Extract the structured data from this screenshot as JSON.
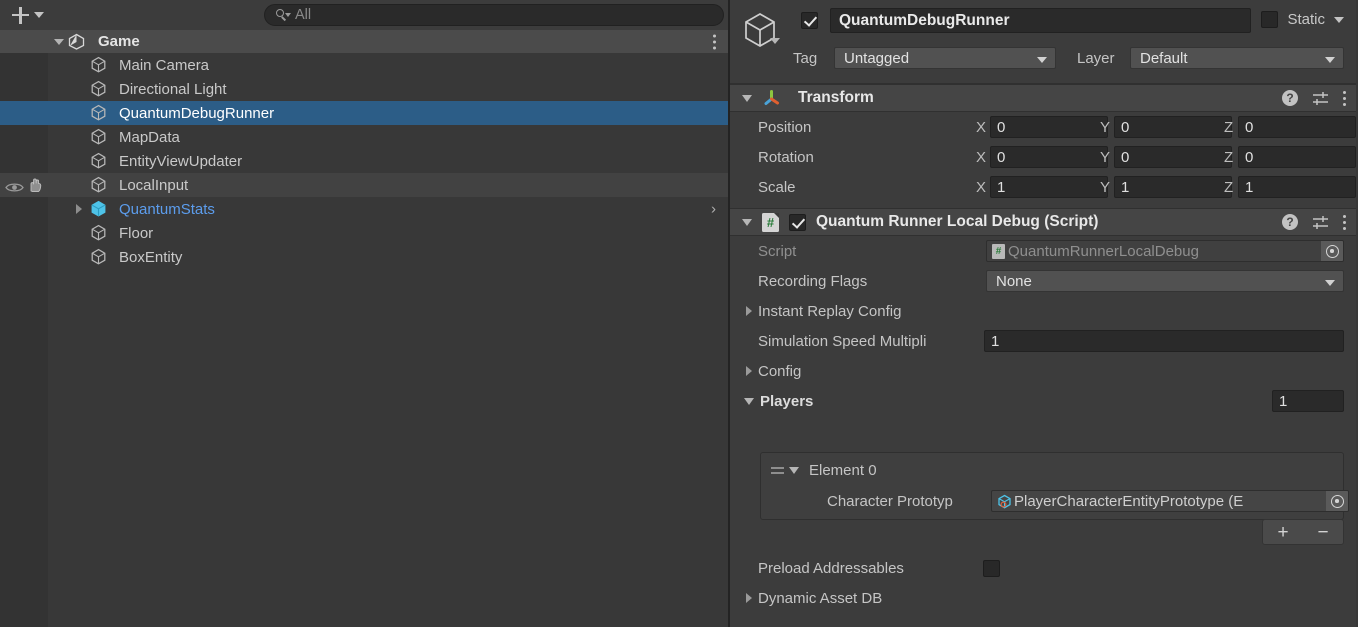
{
  "hierarchy": {
    "toolbar": {
      "add_button_label": "+",
      "add_icon": "plus-icon",
      "dropdown_icon": "chevron-down-icon",
      "search_placeholder": "All",
      "search_value": "",
      "search_icon": "search-icon"
    },
    "scene": {
      "label": "Game",
      "icon": "unity-scene-icon",
      "expanded": true,
      "menu_icon": "kebab-menu-icon"
    },
    "items": [
      {
        "label": "Main Camera",
        "icon": "gameobject-cube-icon",
        "selected": false,
        "prefab": false,
        "indent": 1,
        "expandable": false,
        "hovered": false,
        "visibility_toggles": false
      },
      {
        "label": "Directional Light",
        "icon": "gameobject-cube-icon",
        "selected": false,
        "prefab": false,
        "indent": 1,
        "expandable": false,
        "hovered": false,
        "visibility_toggles": false
      },
      {
        "label": "QuantumDebugRunner",
        "icon": "gameobject-cube-icon",
        "selected": true,
        "prefab": false,
        "indent": 1,
        "expandable": false,
        "hovered": false,
        "visibility_toggles": false
      },
      {
        "label": "MapData",
        "icon": "gameobject-cube-icon",
        "selected": false,
        "prefab": false,
        "indent": 1,
        "expandable": false,
        "hovered": false,
        "visibility_toggles": false
      },
      {
        "label": "EntityViewUpdater",
        "icon": "gameobject-cube-icon",
        "selected": false,
        "prefab": false,
        "indent": 1,
        "expandable": false,
        "hovered": false,
        "visibility_toggles": false
      },
      {
        "label": "LocalInput",
        "icon": "gameobject-cube-icon",
        "selected": false,
        "prefab": false,
        "indent": 1,
        "expandable": false,
        "hovered": true,
        "visibility_toggles": true
      },
      {
        "label": "QuantumStats",
        "icon": "prefab-cube-icon",
        "selected": false,
        "prefab": true,
        "indent": 1,
        "expandable": true,
        "hovered": false,
        "visibility_toggles": false
      },
      {
        "label": "Floor",
        "icon": "gameobject-cube-icon",
        "selected": false,
        "prefab": false,
        "indent": 1,
        "expandable": false,
        "hovered": false,
        "visibility_toggles": false
      },
      {
        "label": "BoxEntity",
        "icon": "gameobject-cube-icon",
        "selected": false,
        "prefab": false,
        "indent": 1,
        "expandable": false,
        "hovered": false,
        "visibility_toggles": false
      }
    ]
  },
  "inspector": {
    "gameobject": {
      "icon": "gameobject-cube-icon",
      "enabled": true,
      "name": "QuantumDebugRunner",
      "static_checked": false,
      "static_label": "Static",
      "tag_label": "Tag",
      "tag_value": "Untagged",
      "layer_label": "Layer",
      "layer_value": "Default"
    },
    "transform": {
      "title": "Transform",
      "icon": "transform-axis-icon",
      "expanded": true,
      "help_icon": "help-icon",
      "preset_icon": "preset-sliders-icon",
      "menu_icon": "kebab-menu-icon",
      "rows": [
        {
          "label": "Position",
          "x": "0",
          "y": "0",
          "z": "0"
        },
        {
          "label": "Rotation",
          "x": "0",
          "y": "0",
          "z": "0"
        },
        {
          "label": "Scale",
          "x": "1",
          "y": "1",
          "z": "1"
        }
      ],
      "axis_labels": [
        "X",
        "Y",
        "Z"
      ]
    },
    "script_component": {
      "title": "Quantum Runner Local Debug (Script)",
      "icon": "csharp-script-icon",
      "enabled": true,
      "expanded": true,
      "help_icon": "help-icon",
      "preset_icon": "preset-sliders-icon",
      "menu_icon": "kebab-menu-icon",
      "script_label": "Script",
      "script_value": "QuantumRunnerLocalDebug",
      "recording_flags_label": "Recording Flags",
      "recording_flags_value": "None",
      "instant_replay_label": "Instant Replay Config",
      "instant_replay_expanded": false,
      "sim_speed_label": "Simulation Speed Multipli",
      "sim_speed_value": "1",
      "config_label": "Config",
      "config_expanded": false,
      "players_label": "Players",
      "players_expanded": true,
      "players_count": "1",
      "element_label": "Element 0",
      "element_expanded": true,
      "character_prototype_label": "Character Prototyp",
      "character_prototype_value": "PlayerCharacterEntityPrototype (E",
      "add_button": "+",
      "remove_button": "−",
      "preload_label": "Preload Addressables",
      "preload_checked": false,
      "dynamic_asset_label": "Dynamic Asset DB",
      "dynamic_asset_expanded": false
    }
  },
  "colors": {
    "selection_blue": "#2c5d87",
    "prefab_blue": "#5c9ded",
    "panel_bg": "#383838",
    "inspector_bg": "#3c3c3c",
    "header_bg": "#454545"
  }
}
